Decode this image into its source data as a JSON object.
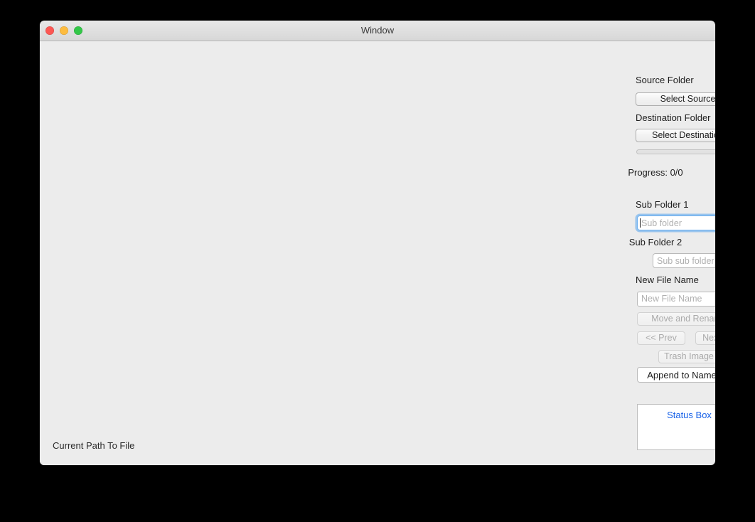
{
  "window": {
    "title": "Window",
    "traffic_lights": [
      {
        "name": "close",
        "color": "#fc5753"
      },
      {
        "name": "minimize",
        "color": "#fdbc40"
      },
      {
        "name": "zoom",
        "color": "#33c748"
      }
    ]
  },
  "preview": {
    "current_path": "Current Path To File"
  },
  "sidebar": {
    "source_folder_label": "Source Folder",
    "select_source_button": "Select Source",
    "destination_folder_label": "Destination Folder",
    "select_destination_button": "Select Destination",
    "progress": {
      "value": 0,
      "total": 0,
      "percent": 0,
      "text": "Progress: 0/0"
    },
    "sub_folder_1": {
      "label": "Sub Folder 1",
      "value": "",
      "placeholder": "Sub folder",
      "focused": true
    },
    "sub_folder_2": {
      "label": "Sub Folder 2",
      "value": "",
      "placeholder": "Sub sub folder",
      "focused": false
    },
    "new_file_name": {
      "label": "New File Name",
      "value": "",
      "placeholder": "New File Name"
    },
    "move_and_rename_button": "Move and Rename",
    "prev_button": "<< Prev",
    "next_button": "Next >>",
    "trash_image_button": "Trash Image",
    "append_mode": {
      "selected": "Append to Name"
    },
    "status_box": {
      "text": "Status Box"
    }
  },
  "colors": {
    "desktop": "#000000",
    "window_body": "#ececec",
    "titlebar_top": "#e8e8e8",
    "titlebar_bottom": "#d7d7d7",
    "accent_blue": "#1b84f3",
    "focus_ring": "#58a5ee",
    "status_text": "#1761e8",
    "disabled_text": "#aaaaaa"
  }
}
